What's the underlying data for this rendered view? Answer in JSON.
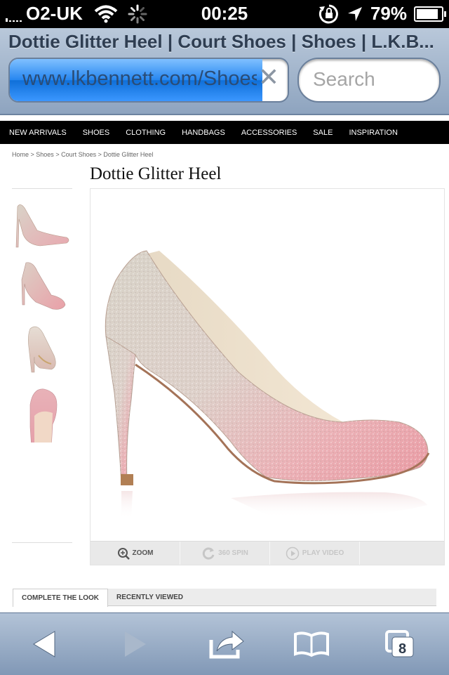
{
  "status_bar": {
    "carrier": "O2-UK",
    "time": "00:25",
    "battery_percent": "79%",
    "battery_level": 0.79,
    "icons": [
      "signal-icon",
      "wifi-icon",
      "activity-spinner-icon",
      "rotation-lock-icon",
      "location-arrow-icon",
      "battery-icon"
    ]
  },
  "browser": {
    "page_title": "Dottie Glitter Heel | Court Shoes | Shoes | L.K.B...",
    "url": "www.lkbennett.com/Shoes/Court-Shoes/Dottie-Glitter-Heel",
    "search_placeholder": "Search",
    "tabs_count": "8",
    "toolbar_icons": [
      "back-arrow-icon",
      "forward-arrow-icon",
      "share-icon",
      "bookmarks-icon",
      "tabs-icon"
    ]
  },
  "site_nav": {
    "items": [
      "NEW ARRIVALS",
      "SHOES",
      "CLOTHING",
      "HANDBAGS",
      "ACCESSORIES",
      "SALE",
      "INSPIRATION"
    ]
  },
  "breadcrumb": {
    "items": [
      "Home",
      "Shoes",
      "Court Shoes",
      "Dottie Glitter Heel"
    ],
    "separator": " > "
  },
  "product": {
    "title": "Dottie Glitter Heel",
    "image_controls": [
      "ZOOM",
      "360 SPIN",
      "PLAY VIDEO"
    ]
  },
  "tabs": {
    "active": "COMPLETE THE LOOK",
    "inactive": "RECENTLY VIEWED"
  },
  "colors": {
    "nav_background": "#000000",
    "safari_chrome": "#8ea4bf",
    "url_progress": "#2586f0",
    "glitter_pink": "#e9a9b0",
    "glitter_silver": "#d8d2c8"
  }
}
